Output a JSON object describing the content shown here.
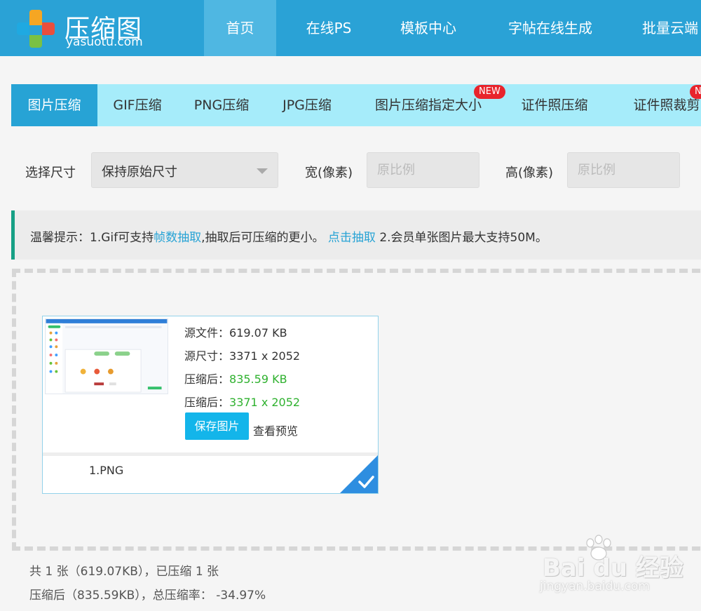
{
  "header": {
    "logo_title": "压缩图",
    "logo_sub": "yasuotu.com",
    "nav": [
      {
        "label": "首页"
      },
      {
        "label": "在线PS"
      },
      {
        "label": "模板中心"
      },
      {
        "label": "字帖在线生成"
      },
      {
        "label": "批量云端"
      }
    ]
  },
  "tabs": [
    {
      "label": "图片压缩"
    },
    {
      "label": "GIF压缩"
    },
    {
      "label": "PNG压缩"
    },
    {
      "label": "JPG压缩"
    },
    {
      "label": "图片压缩指定大小",
      "badge": "NEW"
    },
    {
      "label": "证件照压缩"
    },
    {
      "label": "证件照裁剪",
      "badge": "N"
    }
  ],
  "options": {
    "size_label": "选择尺寸",
    "size_value": "保持原始尺寸",
    "width_label": "宽(像素)",
    "width_placeholder": "原比例",
    "height_label": "高(像素)",
    "height_placeholder": "原比例"
  },
  "notice": {
    "prefix": "温馨提示：1.Gif可支持",
    "link1": "帧数抽取",
    "middle": ",抽取后可压缩的更小。",
    "link2": "点击抽取",
    "suffix": "2.会员单张图片最大支持50M。"
  },
  "file_card": {
    "source_file_label": "源文件：",
    "source_file_value": "619.07 KB",
    "source_size_label": "源尺寸：",
    "source_size_value": "3371 x 2052",
    "compressed_file_label": "压缩后：",
    "compressed_file_value": "835.59 KB",
    "compressed_size_label": "压缩后：",
    "compressed_size_value": "3371 x 2052",
    "save_button": "保存图片",
    "preview_button": "查看预览",
    "filename": "1.PNG"
  },
  "summary": {
    "line1": "共 1 张（619.07KB），已压缩 1 张",
    "line2": "压缩后（835.59KB），总压缩率： -34.97%"
  },
  "watermark": {
    "text": "Bai du 经验",
    "url": "jingyan.baidu.com"
  },
  "colors": {
    "header_bg": "#2aa2d6",
    "tab_bg": "#a6ecfa",
    "tab_active": "#27a3d5",
    "button": "#13b5ea",
    "green_value": "#2fb12f",
    "badge": "#e8242c",
    "notice_border": "#16a085"
  }
}
